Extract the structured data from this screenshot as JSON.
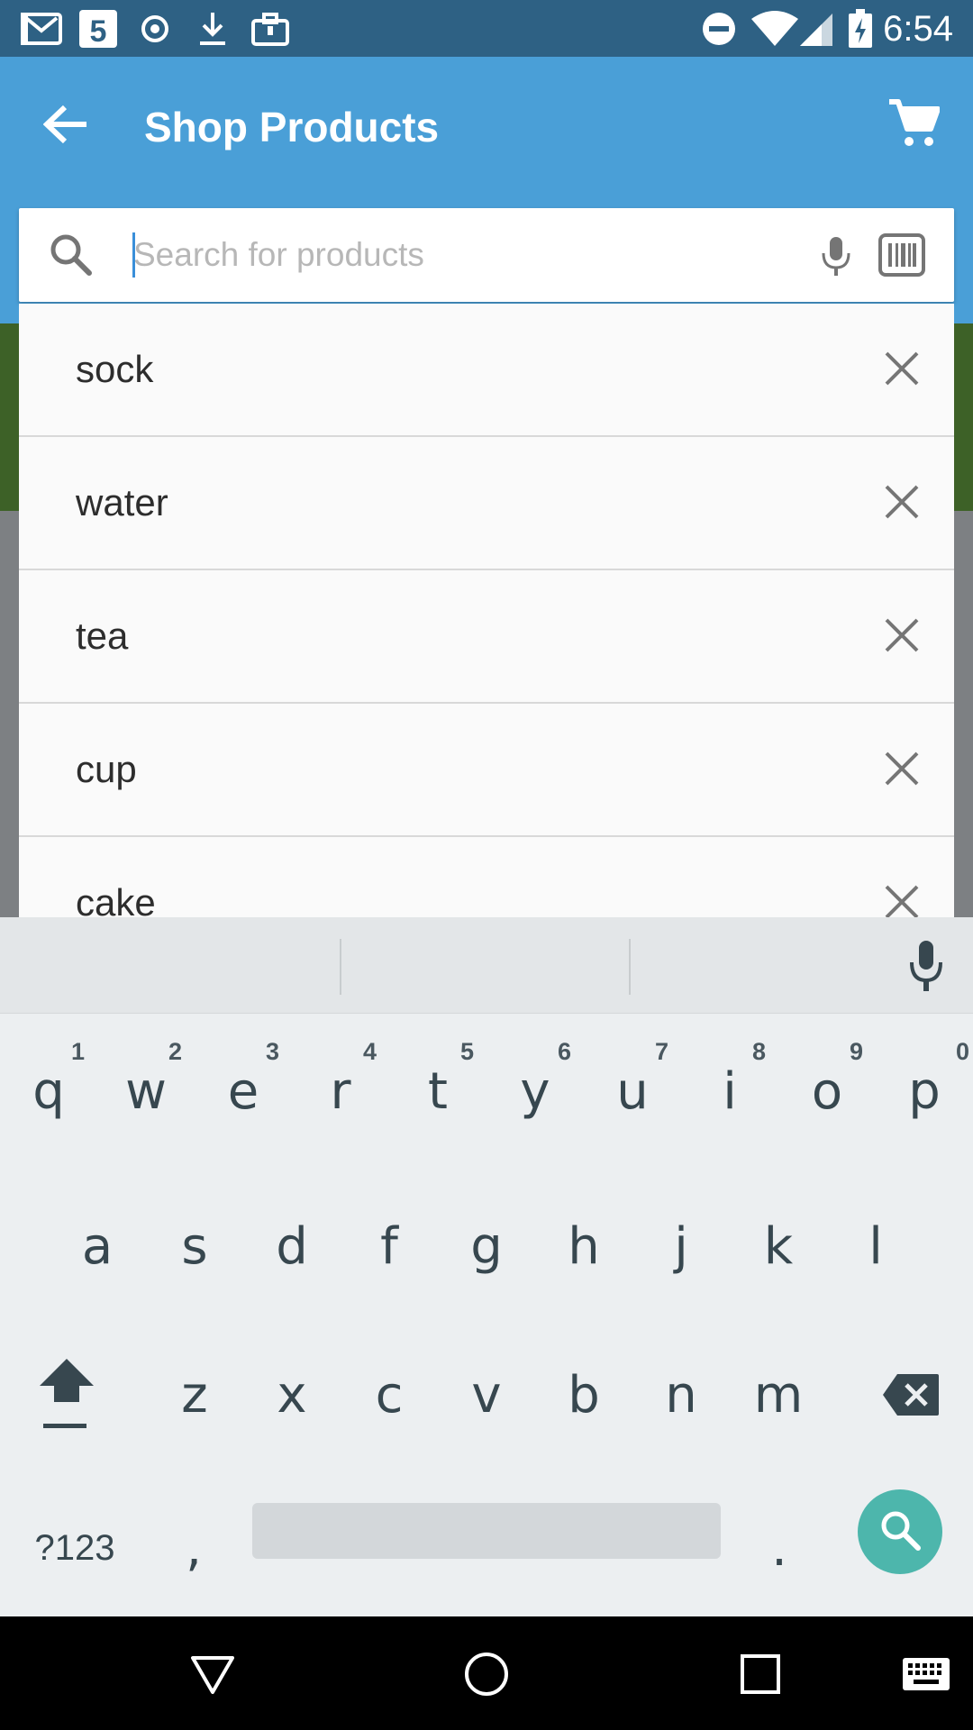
{
  "status_bar": {
    "time": "6:54",
    "left_icons": [
      "gmail-icon",
      "calendar-5-icon",
      "target-icon",
      "download-icon",
      "briefcase-icon"
    ],
    "right_icons": [
      "do-not-disturb-icon",
      "wifi-icon",
      "signal-icon",
      "battery-charging-icon"
    ]
  },
  "app_bar": {
    "title": "Shop Products",
    "back_icon": "arrow-back-icon",
    "cart_icon": "shopping-cart-icon",
    "color": "#4a9fd7"
  },
  "search": {
    "placeholder": "Search for products",
    "value": "",
    "mic_icon": "mic-icon",
    "barcode_icon": "barcode-scanner-icon"
  },
  "suggestions": [
    {
      "label": "sock"
    },
    {
      "label": "water"
    },
    {
      "label": "tea"
    },
    {
      "label": "cup"
    },
    {
      "label": "cake"
    }
  ],
  "keyboard": {
    "row1": [
      {
        "key": "q",
        "hint": "1"
      },
      {
        "key": "w",
        "hint": "2"
      },
      {
        "key": "e",
        "hint": "3"
      },
      {
        "key": "r",
        "hint": "4"
      },
      {
        "key": "t",
        "hint": "5"
      },
      {
        "key": "y",
        "hint": "6"
      },
      {
        "key": "u",
        "hint": "7"
      },
      {
        "key": "i",
        "hint": "8"
      },
      {
        "key": "o",
        "hint": "9"
      },
      {
        "key": "p",
        "hint": "0"
      }
    ],
    "row2": [
      "a",
      "s",
      "d",
      "f",
      "g",
      "h",
      "j",
      "k",
      "l"
    ],
    "row3": [
      "z",
      "x",
      "c",
      "v",
      "b",
      "n",
      "m"
    ],
    "symbols_label": "?123",
    "comma": ",",
    "period": ".",
    "action_color": "#4db6ac"
  },
  "nav_bar": {
    "icons": [
      "back-triangle-icon",
      "home-circle-icon",
      "recents-square-icon",
      "keyboard-switch-icon"
    ]
  }
}
